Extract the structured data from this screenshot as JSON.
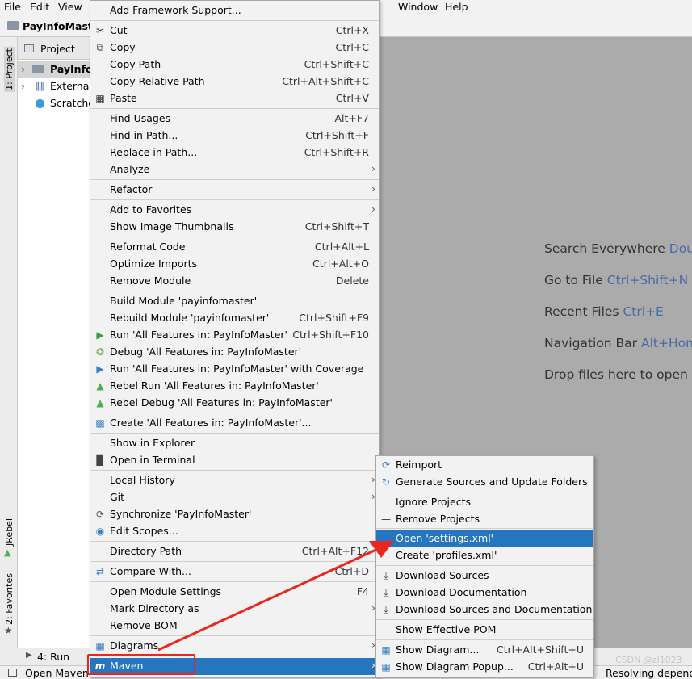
{
  "menubar": {
    "items": [
      "File",
      "Edit",
      "View",
      "Window",
      "Help"
    ]
  },
  "navbar": {
    "project": "PayInfoMaster"
  },
  "leftstrip": {
    "project_tab": "1: Project",
    "jrebel_tab": "JRebel",
    "favorites_tab": "2: Favorites"
  },
  "project_panel": {
    "header": "Project",
    "tree": [
      "PayInfoMaster",
      "External Libraries",
      "Scratches and Consoles"
    ]
  },
  "main_menu": {
    "items": [
      {
        "label": "Add Framework Support...",
        "shortcut": ""
      },
      {
        "label": "Cut",
        "shortcut": "Ctrl+X",
        "icon": "scissors-icon"
      },
      {
        "label": "Copy",
        "shortcut": "Ctrl+C",
        "icon": "copy-icon"
      },
      {
        "label": "Copy Path",
        "shortcut": "Ctrl+Shift+C"
      },
      {
        "label": "Copy Relative Path",
        "shortcut": "Ctrl+Alt+Shift+C"
      },
      {
        "label": "Paste",
        "shortcut": "Ctrl+V",
        "icon": "paste-icon"
      },
      {
        "label": "Find Usages",
        "shortcut": "Alt+F7"
      },
      {
        "label": "Find in Path...",
        "shortcut": "Ctrl+Shift+F"
      },
      {
        "label": "Replace in Path...",
        "shortcut": "Ctrl+Shift+R"
      },
      {
        "label": "Analyze",
        "shortcut": "",
        "submenu": true
      },
      {
        "label": "Refactor",
        "shortcut": "",
        "submenu": true
      },
      {
        "label": "Add to Favorites",
        "shortcut": "",
        "submenu": true
      },
      {
        "label": "Show Image Thumbnails",
        "shortcut": "Ctrl+Shift+T"
      },
      {
        "label": "Reformat Code",
        "shortcut": "Ctrl+Alt+L"
      },
      {
        "label": "Optimize Imports",
        "shortcut": "Ctrl+Alt+O"
      },
      {
        "label": "Remove Module",
        "shortcut": "Delete"
      },
      {
        "label": "Build Module 'payinfomaster'",
        "shortcut": ""
      },
      {
        "label": "Rebuild Module 'payinfomaster'",
        "shortcut": "Ctrl+Shift+F9"
      },
      {
        "label": "Run 'All Features in: PayInfoMaster'",
        "shortcut": "Ctrl+Shift+F10",
        "icon": "run-icon"
      },
      {
        "label": "Debug 'All Features in: PayInfoMaster'",
        "shortcut": "",
        "icon": "debug-icon"
      },
      {
        "label": "Run 'All Features in: PayInfoMaster' with Coverage",
        "shortcut": "",
        "icon": "coverage-icon"
      },
      {
        "label": "Rebel Run 'All Features in: PayInfoMaster'",
        "shortcut": "",
        "icon": "rebel-run-icon"
      },
      {
        "label": "Rebel Debug 'All Features in: PayInfoMaster'",
        "shortcut": "",
        "icon": "rebel-debug-icon"
      },
      {
        "label": "Create 'All Features in: PayInfoMaster'...",
        "shortcut": "",
        "icon": "create-config-icon"
      },
      {
        "label": "Show in Explorer",
        "shortcut": ""
      },
      {
        "label": "Open in Terminal",
        "shortcut": "",
        "icon": "terminal-icon"
      },
      {
        "label": "Local History",
        "shortcut": "",
        "submenu": true
      },
      {
        "label": "Git",
        "shortcut": "",
        "submenu": true
      },
      {
        "label": "Synchronize 'PayInfoMaster'",
        "shortcut": "",
        "icon": "sync-icon"
      },
      {
        "label": "Edit Scopes...",
        "shortcut": "",
        "icon": "scope-icon"
      },
      {
        "label": "Directory Path",
        "shortcut": "Ctrl+Alt+F12"
      },
      {
        "label": "Compare With...",
        "shortcut": "Ctrl+D",
        "icon": "compare-icon"
      },
      {
        "label": "Open Module Settings",
        "shortcut": "F4"
      },
      {
        "label": "Mark Directory as",
        "shortcut": "",
        "submenu": true
      },
      {
        "label": "Remove BOM",
        "shortcut": ""
      },
      {
        "label": "Diagrams",
        "shortcut": "",
        "submenu": true,
        "icon": "diagram-icon"
      },
      {
        "label": "Maven",
        "shortcut": "",
        "submenu": true,
        "icon": "maven-icon",
        "selected": true
      }
    ]
  },
  "maven_menu": {
    "items": [
      {
        "label": "Reimport",
        "shortcut": "",
        "icon": "reimport-icon"
      },
      {
        "label": "Generate Sources and Update Folders",
        "shortcut": "",
        "icon": "generate-icon"
      },
      {
        "label": "Ignore Projects",
        "shortcut": ""
      },
      {
        "label": "Remove Projects",
        "shortcut": "",
        "icon": "minus-icon"
      },
      {
        "label": "Open 'settings.xml'",
        "shortcut": "",
        "selected": true
      },
      {
        "label": "Create 'profiles.xml'",
        "shortcut": ""
      },
      {
        "label": "Download Sources",
        "shortcut": "",
        "icon": "download-icon"
      },
      {
        "label": "Download Documentation",
        "shortcut": "",
        "icon": "download-icon"
      },
      {
        "label": "Download Sources and Documentation",
        "shortcut": "",
        "icon": "download-icon"
      },
      {
        "label": "Show Effective POM",
        "shortcut": ""
      },
      {
        "label": "Show Diagram...",
        "shortcut": "Ctrl+Alt+Shift+U",
        "icon": "diagram-icon"
      },
      {
        "label": "Show Diagram Popup...",
        "shortcut": "Ctrl+Alt+U",
        "icon": "diagram-icon"
      }
    ]
  },
  "editor_hints": [
    {
      "text": "Search Everywhere ",
      "key": "Doubl"
    },
    {
      "text": "Go to File ",
      "key": "Ctrl+Shift+N"
    },
    {
      "text": "Recent Files ",
      "key": "Ctrl+E"
    },
    {
      "text": "Navigation Bar ",
      "key": "Alt+Hom"
    },
    {
      "text": "Drop files here to open",
      "key": ""
    }
  ],
  "bottombar": {
    "run_tab": "4: Run"
  },
  "statusbar": {
    "left": "Open Maven",
    "right": "Resolving depend",
    "watermark": "CSDN @zl1023"
  },
  "colors": {
    "selection": "#2675bf",
    "annotation": "#e8281e",
    "editor_bg": "#ababab"
  }
}
